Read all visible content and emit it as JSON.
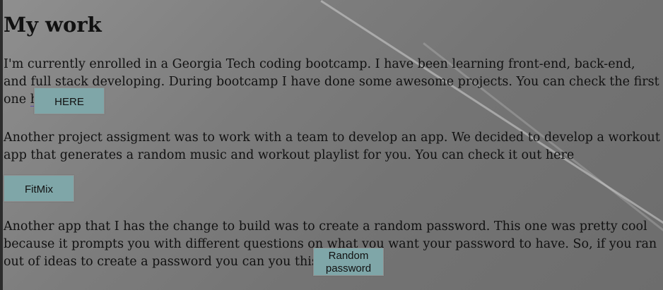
{
  "heading": "My work",
  "section1": {
    "text": "I'm currently enrolled in a Georgia Tech coding bootcamp. I have been learning front-end, back-end, and full stack developing. During bootcamp I have done some awesome projects. You can check the first one here",
    "button_label": "HERE"
  },
  "section2": {
    "text": "Another project assigment was to work with a team to develop an app. We decided to develop a workout app that generates a random music and workout playlist for you. You can check it out here",
    "button_label": "FitMix"
  },
  "section3": {
    "text": "Another app that I has the change to build was to create a random password. This one was pretty cool because it prompts you with different questions on what you want your password to have. So, if you ran out of ideas to create a password you can you this",
    "button_label": "Random password"
  },
  "colors": {
    "button_bg": "#7fa6a8",
    "background": "#7d7d7d"
  }
}
